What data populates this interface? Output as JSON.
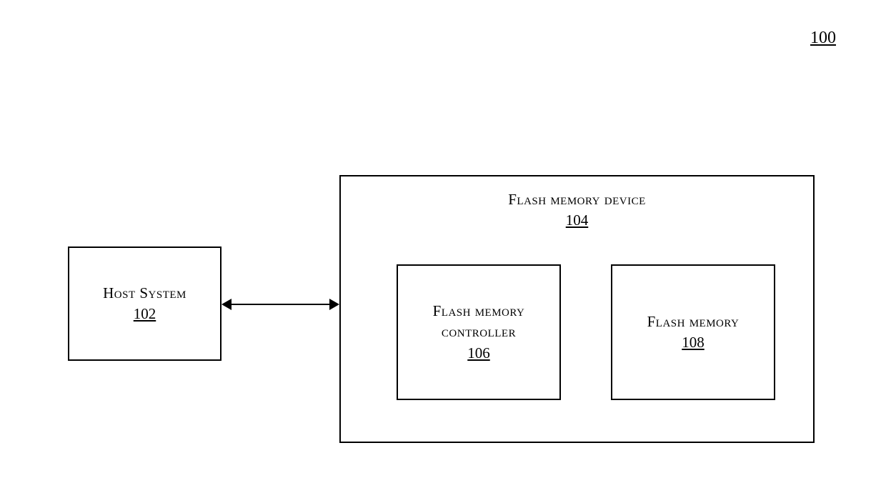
{
  "figure_number": "100",
  "host": {
    "title": "Host System",
    "ref": "102"
  },
  "device": {
    "title": "Flash memory device",
    "ref": "104"
  },
  "controller": {
    "title": "Flash memory controller",
    "ref": "106"
  },
  "memory": {
    "title": "Flash memory",
    "ref": "108"
  }
}
